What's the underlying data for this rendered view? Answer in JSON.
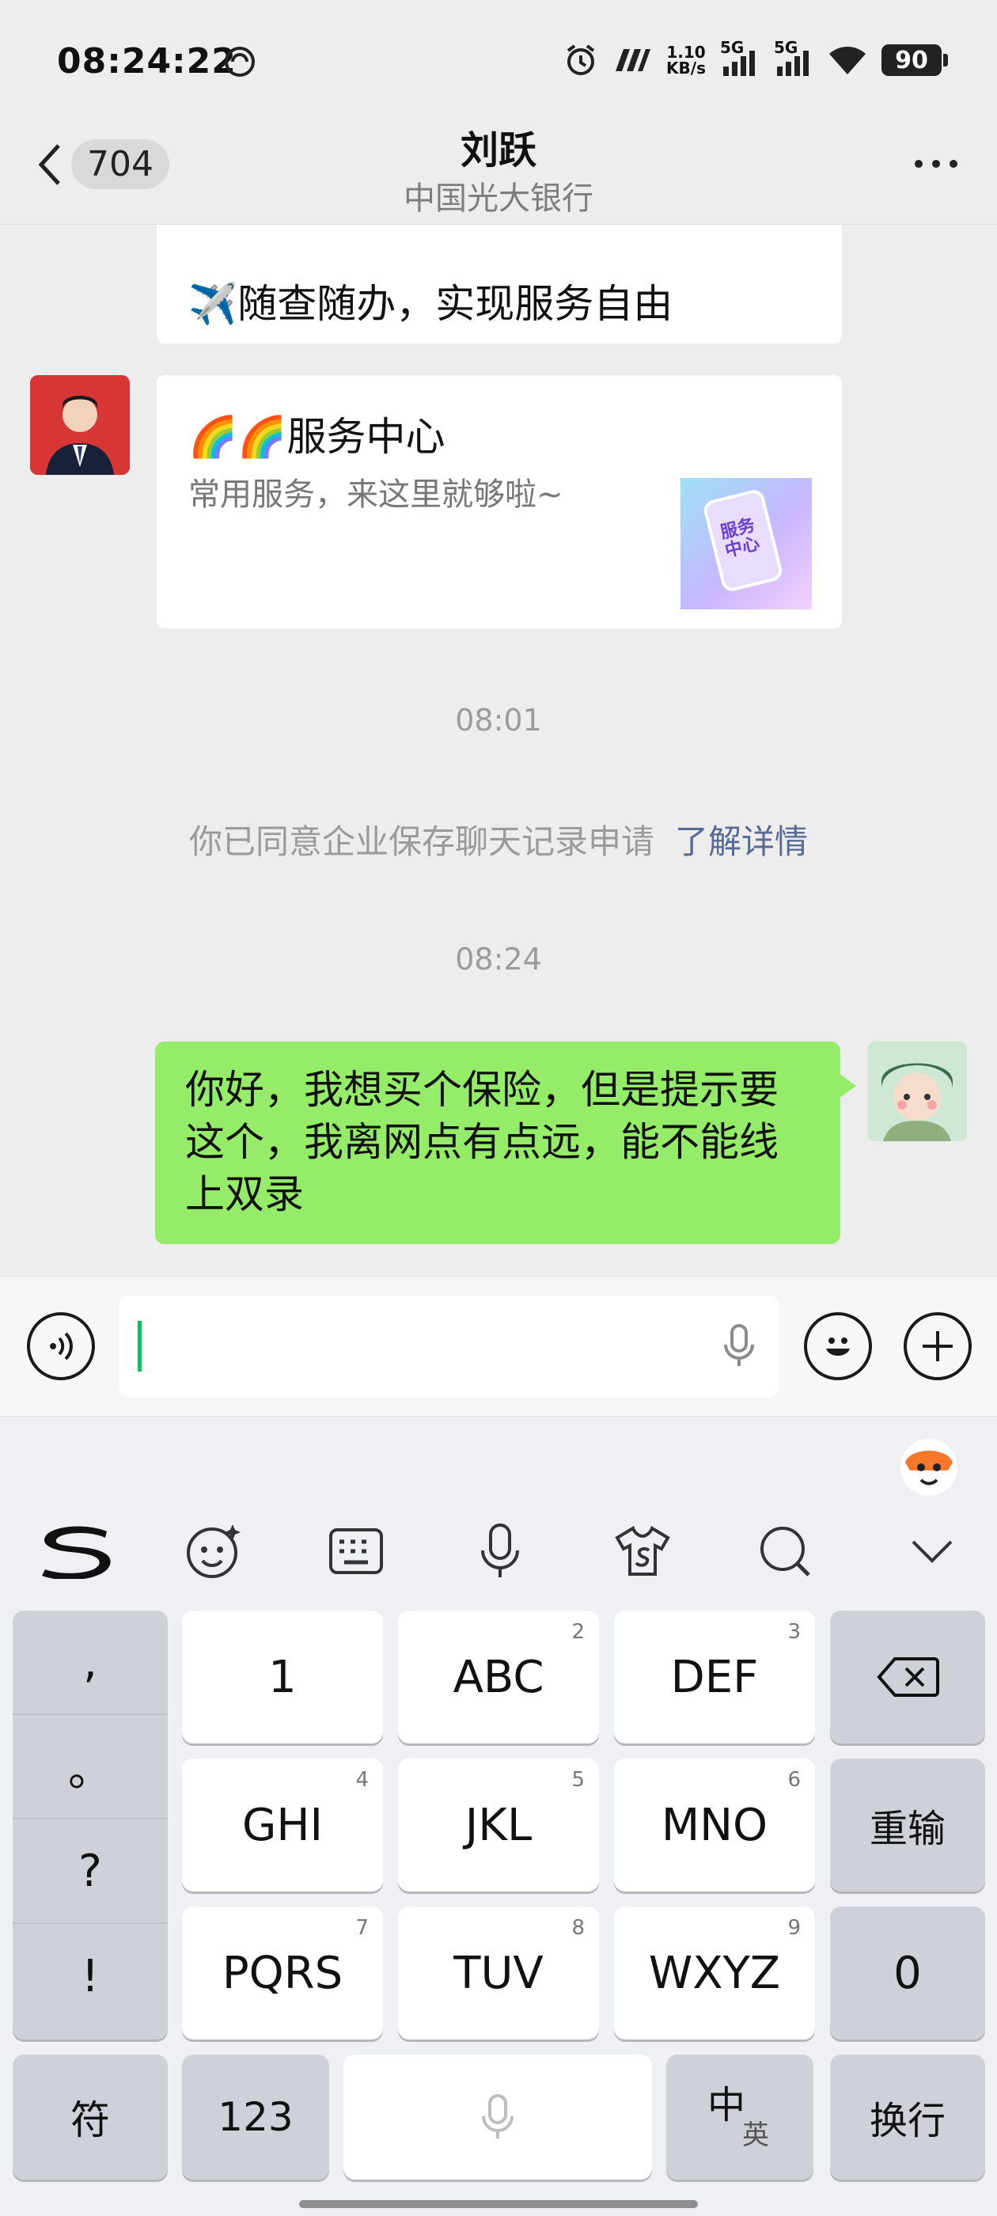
{
  "status": {
    "time": "08:24:22",
    "net_speed_value": "1.10",
    "net_speed_unit": "KB/s",
    "sig1": "5G",
    "sig2": "5G",
    "battery": "90"
  },
  "header": {
    "back_count": "704",
    "title": "刘跃",
    "subtitle": "中国光大银行"
  },
  "chat": {
    "card_top_text": "✈️随查随办，实现服务自由",
    "service_title": "🌈🌈服务中心",
    "service_desc": "常用服务，来这里就够啦~",
    "service_thumb_text": "服务中心",
    "time1": "08:01",
    "system_msg": "你已同意企业保存聊天记录申请",
    "system_link": "了解详情",
    "time2": "08:24",
    "my_msg": "你好，我想买个保险，但是提示要这个，我离网点有点远，能不能线上双录"
  },
  "keyboard": {
    "punct": [
      ",",
      "。",
      "?",
      "!"
    ],
    "row1": [
      {
        "label": "1",
        "sub": ""
      },
      {
        "label": "ABC",
        "sub": "2"
      },
      {
        "label": "DEF",
        "sub": "3"
      }
    ],
    "row2": [
      {
        "label": "GHI",
        "sub": "4"
      },
      {
        "label": "JKL",
        "sub": "5"
      },
      {
        "label": "MNO",
        "sub": "6"
      }
    ],
    "row3": [
      {
        "label": "PQRS",
        "sub": "7"
      },
      {
        "label": "TUV",
        "sub": "8"
      },
      {
        "label": "WXYZ",
        "sub": "9"
      }
    ],
    "reset": "重输",
    "zero": "0",
    "symbols": "符",
    "numbers": "123",
    "lang_main": "中",
    "lang_sub": "英",
    "enter": "换行"
  }
}
